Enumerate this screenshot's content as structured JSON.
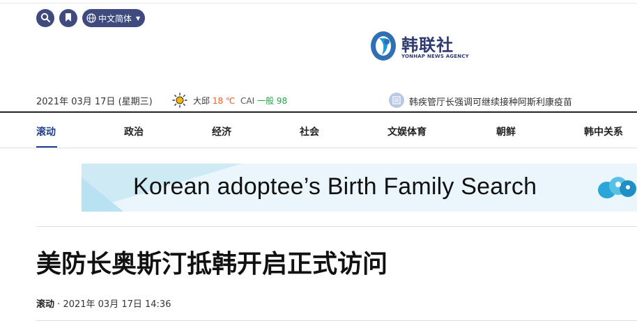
{
  "header": {
    "language_label": "中文简体",
    "logo": {
      "brand": "韩联社",
      "subtitle": "YONHAP NEWS AGENCY"
    }
  },
  "infobar": {
    "date": "2021年 03月 17日 (星期三)",
    "weather_city": "大邱",
    "temperature": "18 ℃",
    "cai_label": "CAI",
    "cai_value": "一般 98",
    "ticker": "韩疾管厅长强调可继续接种阿斯利康疫苗"
  },
  "nav": {
    "items": [
      "滚动",
      "政治",
      "经济",
      "社会",
      "文娱体育",
      "朝鲜",
      "韩中关系"
    ],
    "active_index": 0
  },
  "banner": {
    "text": "Korean adoptee’s Birth Family Search"
  },
  "article": {
    "title": "美防长奥斯汀抵韩开启正式访问",
    "section": "滚动",
    "separator": "·",
    "datetime": "2021年 03月 17日 14:36"
  },
  "colors": {
    "brand_navy": "#3f4b7f",
    "nav_active": "#1e3f8f",
    "temperature": "#e4602d",
    "cai_good": "#2aa14a"
  },
  "icons": [
    "search-icon",
    "bookmark-icon",
    "globe-icon",
    "chevron-down-icon",
    "sun-icon",
    "news-icon"
  ]
}
